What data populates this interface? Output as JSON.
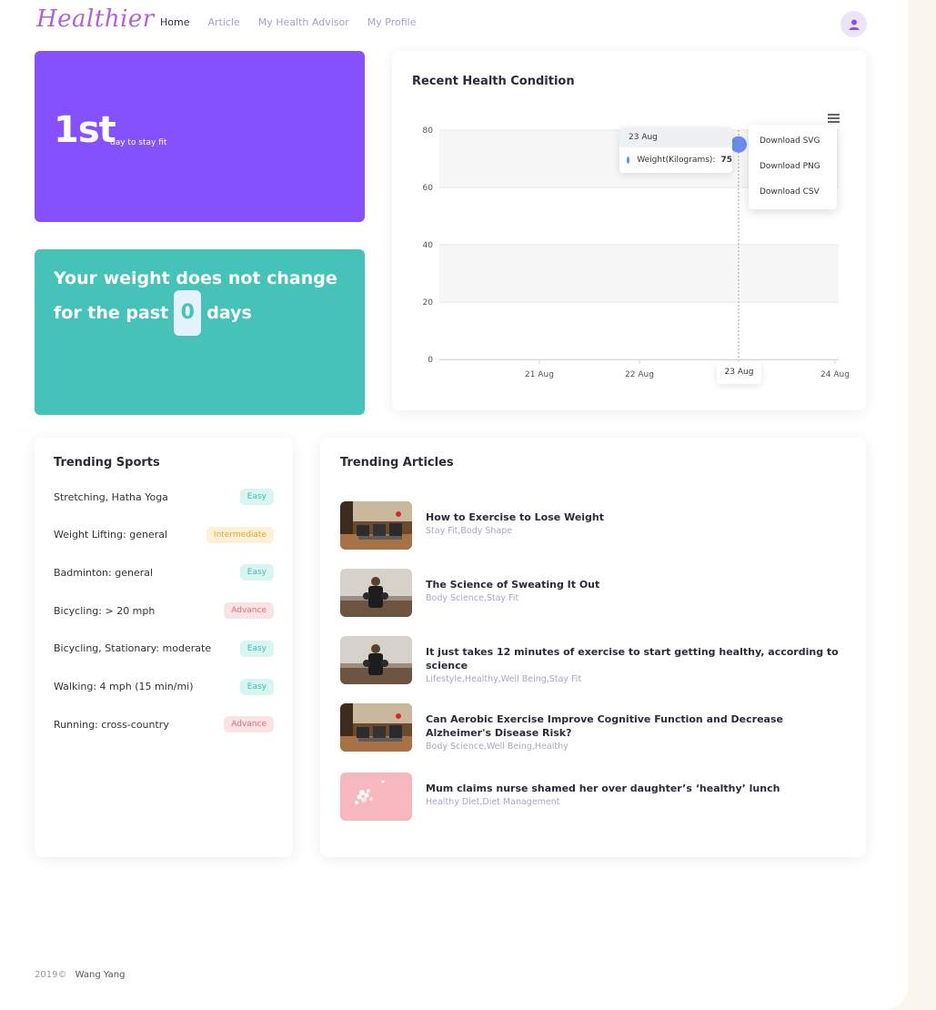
{
  "header": {
    "logo": "Healthier",
    "nav": [
      "Home",
      "Article",
      "My Health Advisor",
      "My Profile"
    ]
  },
  "day_card": {
    "number": "1st",
    "text": "day to stay fit",
    "color": "#8551ff"
  },
  "weight_card": {
    "line1": "Your weight does not change",
    "line2_before": "for the past",
    "days": "0",
    "line2_after": "days",
    "color": "#46c3b8"
  },
  "chart_card": {
    "title": "Recent Health Condition",
    "tooltip": {
      "date": "23 Aug",
      "series": "Weight(Kilograms):",
      "value": "75"
    },
    "menu": [
      "Download SVG",
      "Download PNG",
      "Download CSV"
    ],
    "x_tooltip": "23 Aug"
  },
  "chart_data": {
    "type": "line",
    "x": [
      "23 Aug"
    ],
    "x_ticks": [
      "21 Aug",
      "22 Aug",
      "23 Aug",
      "24 Aug"
    ],
    "y_ticks": [
      0,
      20,
      40,
      60,
      80
    ],
    "ylim": [
      0,
      80
    ],
    "series": [
      {
        "name": "Weight(Kilograms)",
        "values": [
          75
        ],
        "color": "#6b8ef0"
      }
    ],
    "grid": true
  },
  "sports": {
    "title": "Trending Sports",
    "items": [
      {
        "name": "Stretching, Hatha Yoga",
        "level": "Easy",
        "kind": "easy"
      },
      {
        "name": "Weight Lifting: general",
        "level": "Intermediate",
        "kind": "intermediate"
      },
      {
        "name": "Badminton: general",
        "level": "Easy",
        "kind": "easy"
      },
      {
        "name": "Bicycling: > 20 mph",
        "level": "Advance",
        "kind": "advance"
      },
      {
        "name": "Bicycling, Stationary: moderate",
        "level": "Easy",
        "kind": "easy"
      },
      {
        "name": "Walking: 4 mph (15 min/mi)",
        "level": "Easy",
        "kind": "easy"
      },
      {
        "name": "Running: cross-country",
        "level": "Advance",
        "kind": "advance"
      }
    ]
  },
  "articles": {
    "title": "Trending Articles",
    "items": [
      {
        "title": "How to Exercise to Lose Weight",
        "tags": "Stay Fit,Body Shape",
        "thumb": "gym"
      },
      {
        "title": "The Science of Sweating It Out",
        "tags": "Body Science,Stay Fit",
        "thumb": "boxer"
      },
      {
        "title": "It just takes 12 minutes of exercise to start getting healthy, according to science",
        "tags": "Lifestyle,Healthy,Well Being,Stay Fit",
        "thumb": "boxer"
      },
      {
        "title": "Can Aerobic Exercise Improve Cognitive Function and Decrease Alzheimer's Disease Risk?",
        "tags": "Body Science,Well Being,Healthy",
        "thumb": "gym"
      },
      {
        "title": "Mum claims nurse shamed her over daughter’s ‘healthy’ lunch",
        "tags": "Healthy Diet,Diet Management",
        "thumb": "pink"
      }
    ]
  },
  "footer": {
    "year": "2019©",
    "author": "Wang Yang"
  }
}
